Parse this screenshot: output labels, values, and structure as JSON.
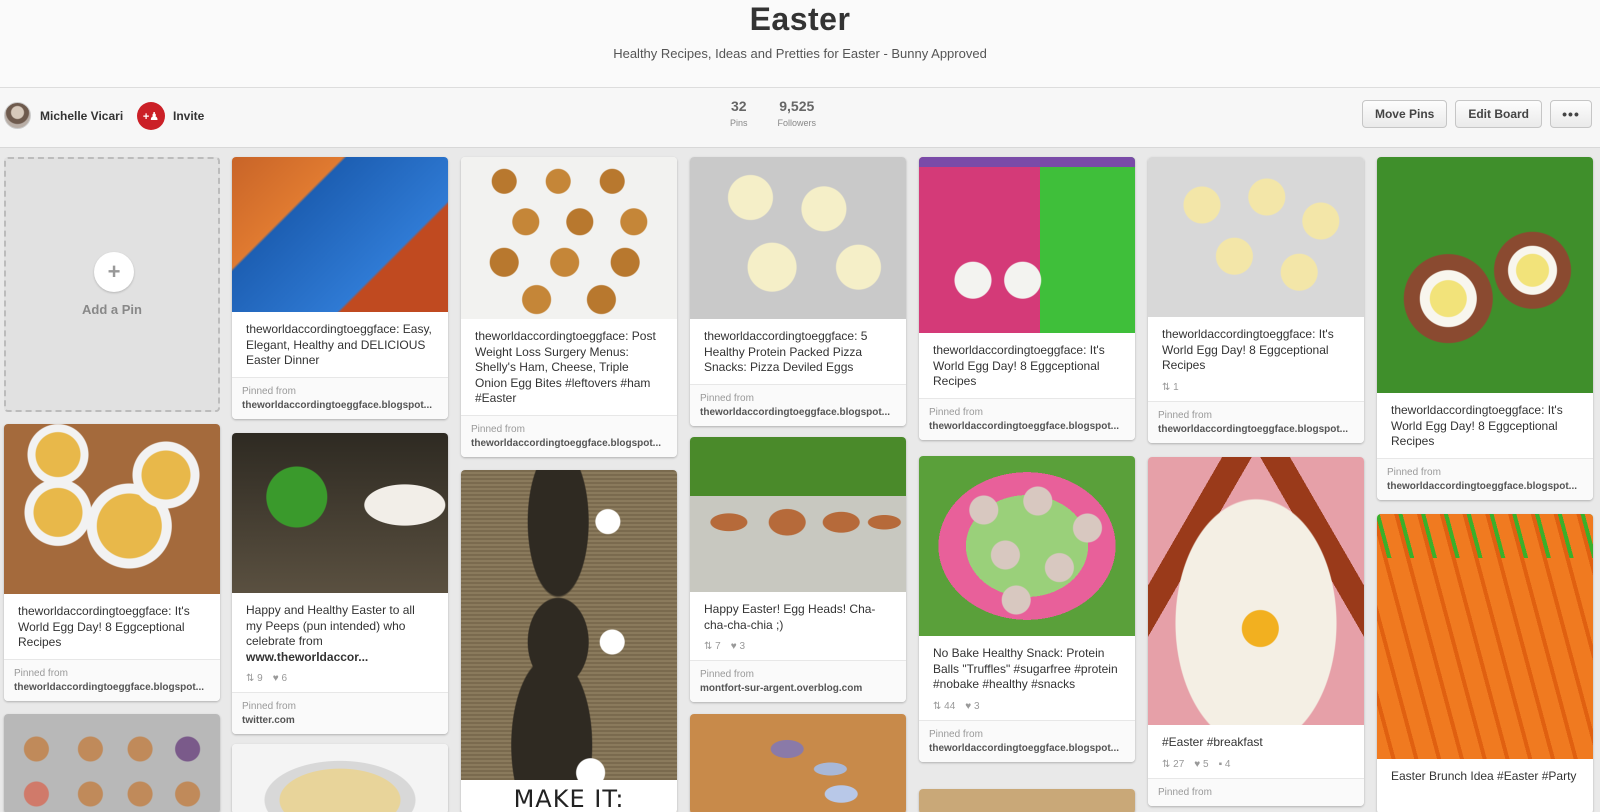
{
  "board": {
    "title": "Easter",
    "description": "Healthy Recipes, Ideas and Pretties for Easter - Bunny Approved",
    "owner": "Michelle Vicari",
    "invite_label": "Invite",
    "invite_icon": "add-person-icon",
    "stats": [
      {
        "value": "32",
        "label": "Pins"
      },
      {
        "value": "9,525",
        "label": "Followers"
      }
    ],
    "actions": {
      "move": "Move Pins",
      "edit": "Edit Board",
      "more": "•••"
    },
    "add_pin_label": "Add a Pin",
    "add_pin_icon": "+"
  },
  "pins": {
    "salmon": {
      "desc": "theworldaccordingtoeggface: Easy, Elegant, Healthy and DELICIOUS Easter Dinner",
      "src_label": "Pinned from",
      "src": "theworldaccordingtoeggface.blogspot..."
    },
    "eggbites": {
      "desc": "theworldaccordingtoeggface: Post Weight Loss Surgery Menus: Shelly's Ham, Cheese, Triple Onion Egg Bites #leftovers #ham #Easter",
      "src_label": "Pinned from",
      "src": "theworldaccordingtoeggface.blogspot..."
    },
    "pizzaeggs": {
      "desc": "theworldaccordingtoeggface: 5 Healthy Protein Packed Pizza Snacks: Pizza Deviled Eggs",
      "src_label": "Pinned from",
      "src": "theworldaccordingtoeggface.blogspot..."
    },
    "bento": {
      "desc": "theworldaccordingtoeggface: It's World Egg Day! 8 Eggceptional Recipes",
      "src_label": "Pinned from",
      "src": "theworldaccordingtoeggface.blogspot..."
    },
    "devilled2": {
      "desc": "theworldaccordingtoeggface: It's World Egg Day! 8 Eggceptional Recipes",
      "repins": "1",
      "src_label": "Pinned from",
      "src": "theworldaccordingtoeggface.blogspot..."
    },
    "scotch": {
      "desc": "theworldaccordingtoeggface: It's World Egg Day! 8 Eggceptional Recipes",
      "src_label": "Pinned from",
      "src": "theworldaccordingtoeggface.blogspot..."
    },
    "souffle": {
      "desc": "theworldaccordingtoeggface: It's World Egg Day! 8 Eggceptional Recipes",
      "src_label": "Pinned from",
      "src": "theworldaccordingtoeggface.blogspot..."
    },
    "bunnycart": {
      "desc_line": "Happy and Healthy Easter to all my Peeps (pun intended) who celebrate from",
      "desc_bold": "www.theworldaccor...",
      "repins": "9",
      "likes": "6",
      "src_label": "Pinned from",
      "src": "twitter.com"
    },
    "burlap": {
      "overlay": "MAKE IT:"
    },
    "eggheads": {
      "desc": "Happy Easter! Egg Heads! Cha-cha-cha-chia ;)",
      "repins": "7",
      "likes": "3",
      "src_label": "Pinned from",
      "src": "montfort-sur-argent.overblog.com"
    },
    "protein": {
      "desc": "No Bake Healthy Snack: Protein Balls \"Truffles\" #sugarfree #protein #nobake #healthy #snacks",
      "repins": "44",
      "likes": "3",
      "src_label": "Pinned from",
      "src": "theworldaccordingtoeggface.blogspot..."
    },
    "pancake": {
      "desc": "#Easter #breakfast",
      "repins": "27",
      "likes": "5",
      "comments": "4",
      "src_label": "Pinned from"
    },
    "carrots": {
      "desc": "Easter Brunch Idea #Easter #Party"
    }
  },
  "icons": {
    "repin": "repin-icon",
    "like": "heart-icon",
    "comment": "comment-icon"
  }
}
